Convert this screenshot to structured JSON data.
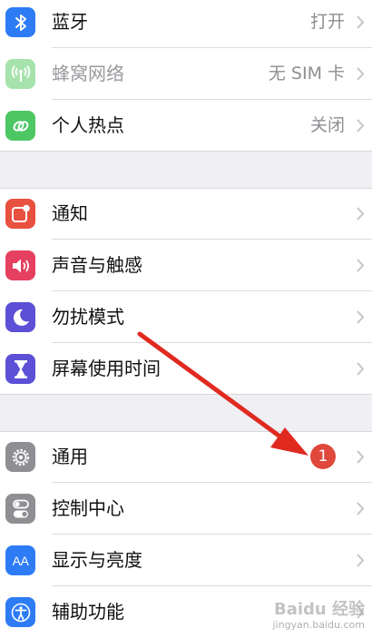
{
  "group1": {
    "bluetooth": {
      "label": "蓝牙",
      "value": "打开",
      "icon": "bluetooth-icon",
      "color": "#2d7cf6"
    },
    "cellular": {
      "label": "蜂窝网络",
      "value": "无 SIM 卡",
      "icon": "cellular-antenna-icon",
      "color": "#a6e3ac"
    },
    "hotspot": {
      "label": "个人热点",
      "value": "关闭",
      "icon": "hotspot-link-icon",
      "color": "#4cc764"
    }
  },
  "group2": {
    "notifications": {
      "label": "通知",
      "icon": "notifications-icon",
      "color": "#e8503f"
    },
    "sounds": {
      "label": "声音与触感",
      "icon": "speaker-icon",
      "color": "#e5405f"
    },
    "dnd": {
      "label": "勿扰模式",
      "icon": "moon-icon",
      "color": "#5b50d6"
    },
    "screentime": {
      "label": "屏幕使用时间",
      "icon": "hourglass-icon",
      "color": "#5b50d6"
    }
  },
  "group3": {
    "general": {
      "label": "通用",
      "badge": "1",
      "icon": "gear-icon",
      "color": "#8e8e93"
    },
    "control_center": {
      "label": "控制中心",
      "icon": "toggles-icon",
      "color": "#8e8e93"
    },
    "display": {
      "label": "显示与亮度",
      "icon": "text-size-icon",
      "icon_text": "AA",
      "color": "#2d7cf6"
    },
    "accessibility": {
      "label": "辅助功能",
      "icon": "accessibility-icon",
      "color": "#2d7cf6"
    }
  },
  "annotation": {
    "arrow_color": "#e02a20"
  },
  "watermark": {
    "brand": "Baidu 经验",
    "url": "jingyan.baidu.com"
  }
}
